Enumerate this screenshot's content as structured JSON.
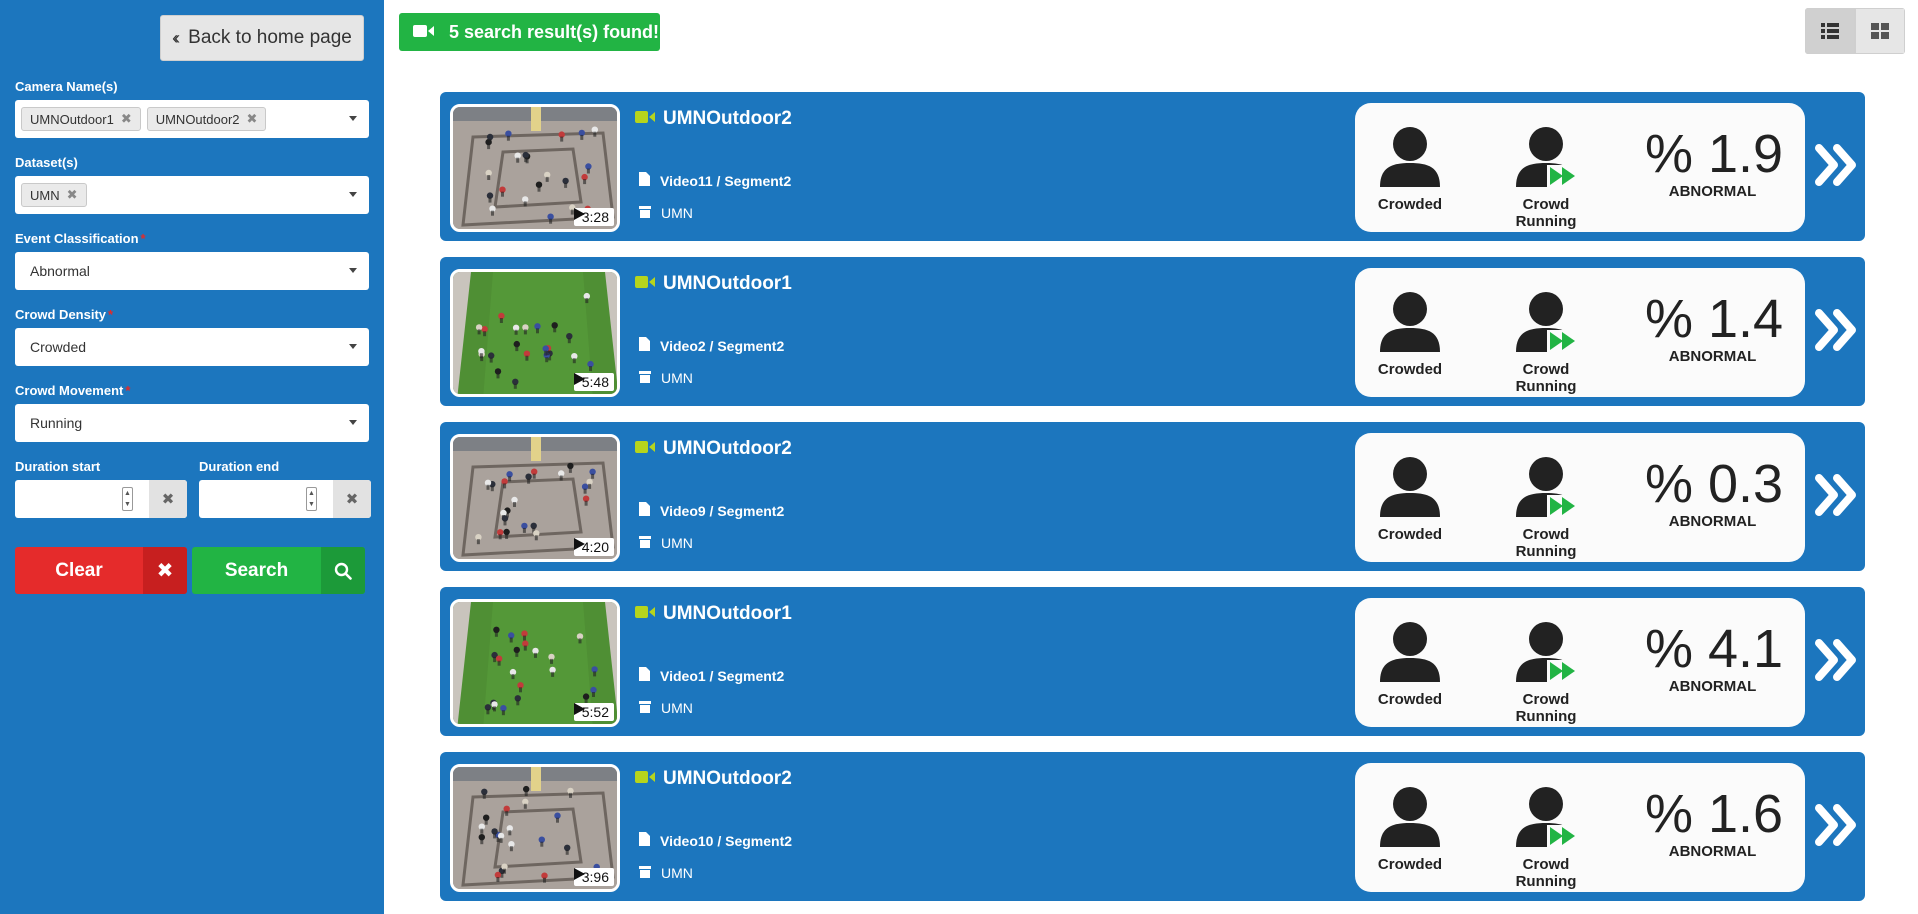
{
  "sidebar": {
    "back_label": "Back to home page",
    "camera_label": "Camera Name(s)",
    "camera_tags": [
      "UMNOutdoor1",
      "UMNOutdoor2"
    ],
    "dataset_label": "Dataset(s)",
    "dataset_tags": [
      "UMN"
    ],
    "event_label": "Event Classification",
    "event_value": "Abnormal",
    "density_label": "Crowd Density",
    "density_value": "Crowded",
    "movement_label": "Crowd Movement",
    "movement_value": "Running",
    "duration_start_label": "Duration start",
    "duration_end_label": "Duration end",
    "duration_start_value": "",
    "duration_end_value": "",
    "clear_label": "Clear",
    "search_label": "Search",
    "required_mark": "*"
  },
  "header": {
    "found_text": "5 search result(s) found!",
    "view_modes": [
      "list-view-icon",
      "grid-view-icon"
    ],
    "active_view": "list-view-icon"
  },
  "colors": {
    "sidebar_bg": "#1c76be",
    "accent_green": "#22b444",
    "danger_red": "#e52b2b",
    "camera_icon": "#b6d41c"
  },
  "results": [
    {
      "camera": "UMNOutdoor2",
      "segment": "Video11 / Segment2",
      "dataset": "UMN",
      "duration": "3:28",
      "density": "Crowded",
      "movement": "Crowd Running",
      "score": "% 1.9",
      "classification": "ABNORMAL",
      "scene": "plaza"
    },
    {
      "camera": "UMNOutdoor1",
      "segment": "Video2 / Segment2",
      "dataset": "UMN",
      "duration": "5:48",
      "density": "Crowded",
      "movement": "Crowd Running",
      "score": "% 1.4",
      "classification": "ABNORMAL",
      "scene": "grass"
    },
    {
      "camera": "UMNOutdoor2",
      "segment": "Video9 / Segment2",
      "dataset": "UMN",
      "duration": "4:20",
      "density": "Crowded",
      "movement": "Crowd Running",
      "score": "% 0.3",
      "classification": "ABNORMAL",
      "scene": "plaza"
    },
    {
      "camera": "UMNOutdoor1",
      "segment": "Video1 / Segment2",
      "dataset": "UMN",
      "duration": "5:52",
      "density": "Crowded",
      "movement": "Crowd Running",
      "score": "% 4.1",
      "classification": "ABNORMAL",
      "scene": "grass"
    },
    {
      "camera": "UMNOutdoor2",
      "segment": "Video10 / Segment2",
      "dataset": "UMN",
      "duration": "3:96",
      "density": "Crowded",
      "movement": "Crowd Running",
      "score": "% 1.6",
      "classification": "ABNORMAL",
      "scene": "plaza"
    }
  ]
}
